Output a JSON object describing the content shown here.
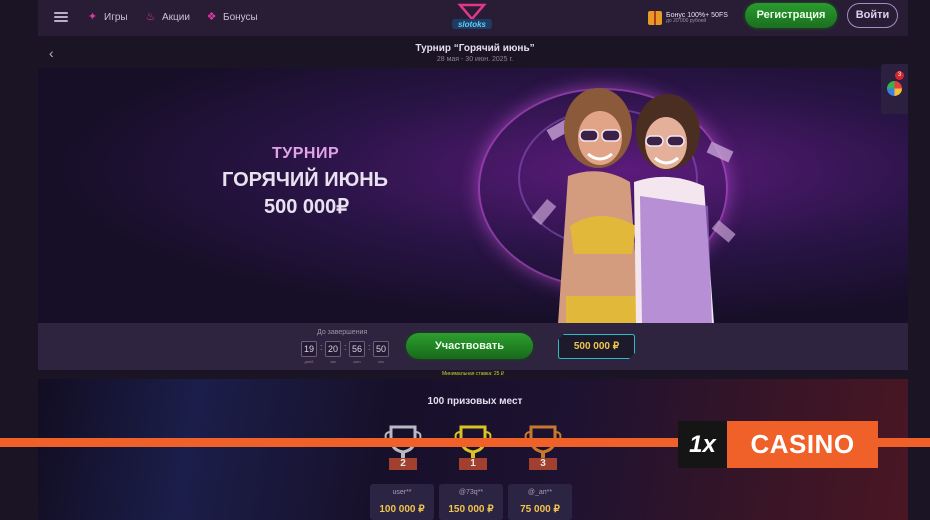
{
  "header": {
    "nav": [
      {
        "label": "Игры",
        "icon": "games-icon"
      },
      {
        "label": "Акции",
        "icon": "fire-icon"
      },
      {
        "label": "Бонусы",
        "icon": "gift-icon"
      }
    ],
    "logo_alt": "slotoks",
    "bonus": {
      "line1": "Бонус 100%+ 50FS",
      "line2": "до 20 000 рублей"
    },
    "register_label": "Регистрация",
    "login_label": "Войти"
  },
  "title": {
    "text": "Турнир “Горячий июнь”",
    "dates": "28 мая - 30 июн. 2025 г."
  },
  "banner": {
    "line1": "ТУРНИР",
    "line2": "ГОРЯЧИЙ ИЮНЬ",
    "line3": "500 000₽"
  },
  "side_widget": {
    "badge": "3"
  },
  "action": {
    "countdown_label": "До завершения",
    "countdown": [
      {
        "value": "19",
        "unit": "дней"
      },
      {
        "value": "20",
        "unit": "час"
      },
      {
        "value": "56",
        "unit": "мин"
      },
      {
        "value": "50",
        "unit": "сек"
      }
    ],
    "join_label": "Участвовать",
    "prize_pool": "500 000 ₽",
    "min_bet": "Минимальная ставка: 25 ₽"
  },
  "prizes": {
    "heading": "100 призовых мест",
    "places": [
      {
        "place": "2",
        "name": "user**",
        "prize": "100 000 ₽",
        "cup_color": "#b9b9c4"
      },
      {
        "place": "1",
        "name": "@73q**",
        "prize": "150 000 ₽",
        "cup_color": "#d9c323"
      },
      {
        "place": "3",
        "name": "@_ап**",
        "prize": "75 000 ₽",
        "cup_color": "#c9782b"
      }
    ]
  },
  "watermark": {
    "logo": "1x",
    "text": "CASINO"
  },
  "colors": {
    "accent_green": "#2d9e2f",
    "accent_gold": "#f2c44d",
    "accent_orange": "#f0612a"
  }
}
